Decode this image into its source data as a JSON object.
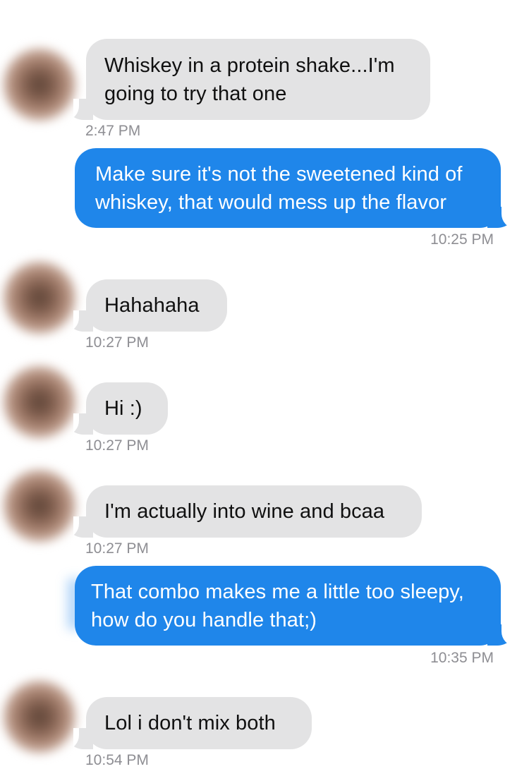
{
  "messages": [
    {
      "sender": "contact",
      "text": "Whiskey in a protein shake...I'm\ngoing to try that one",
      "time": "2:47 PM"
    },
    {
      "sender": "me",
      "text": "Make sure it's not the sweetened kind of\nwhiskey, that would mess up the flavor",
      "time": "10:25 PM"
    },
    {
      "sender": "contact",
      "text": "Hahahaha",
      "time": "10:27 PM"
    },
    {
      "sender": "contact",
      "text": "Hi :)",
      "time": "10:27 PM"
    },
    {
      "sender": "contact",
      "text": "I'm actually into wine and bcaa",
      "time": "10:27 PM"
    },
    {
      "sender": "me",
      "text": "That combo makes me a little too sleepy,\nhow do you handle that;)",
      "time": "10:35 PM"
    },
    {
      "sender": "contact",
      "text": "Lol i don't mix both",
      "time": "10:54 PM"
    }
  ],
  "colors": {
    "incoming_bubble": "#e3e3e4",
    "outgoing_bubble": "#1f86ea",
    "timestamp": "#8e8e93",
    "background": "#ffffff"
  },
  "icons": {
    "avatar": "blurred-profile-photo"
  }
}
